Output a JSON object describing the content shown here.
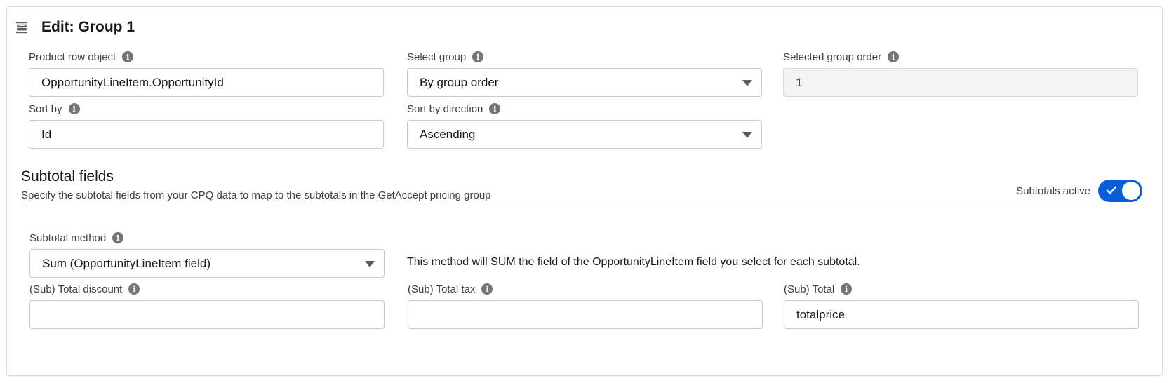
{
  "header": {
    "title": "Edit: Group 1",
    "icon": "group-list-icon"
  },
  "group_fields": {
    "product_row_object": {
      "label": "Product row object",
      "value": "OpportunityLineItem.OpportunityId"
    },
    "select_group": {
      "label": "Select group",
      "value": "By group order"
    },
    "selected_group_order": {
      "label": "Selected group order",
      "value": "1"
    },
    "sort_by": {
      "label": "Sort by",
      "value": "Id"
    },
    "sort_direction": {
      "label": "Sort by direction",
      "value": "Ascending"
    }
  },
  "subtotals": {
    "title": "Subtotal fields",
    "description": "Specify the subtotal fields from your CPQ data to map to the subtotals in the GetAccept pricing group",
    "toggle_label": "Subtotals active",
    "toggle_on": true,
    "method": {
      "label": "Subtotal method",
      "value": "Sum (OpportunityLineItem field)"
    },
    "method_note": "This method will SUM the field of the OpportunityLineItem field you select for each subtotal.",
    "total_discount": {
      "label": "(Sub) Total discount",
      "value": ""
    },
    "total_tax": {
      "label": "(Sub) Total tax",
      "value": ""
    },
    "total": {
      "label": "(Sub) Total",
      "value": "totalprice"
    }
  },
  "colors": {
    "accent": "#0b5cd8",
    "info_icon": "#747474",
    "border": "#c9c9c9",
    "readonly_bg": "#f3f3f3"
  }
}
